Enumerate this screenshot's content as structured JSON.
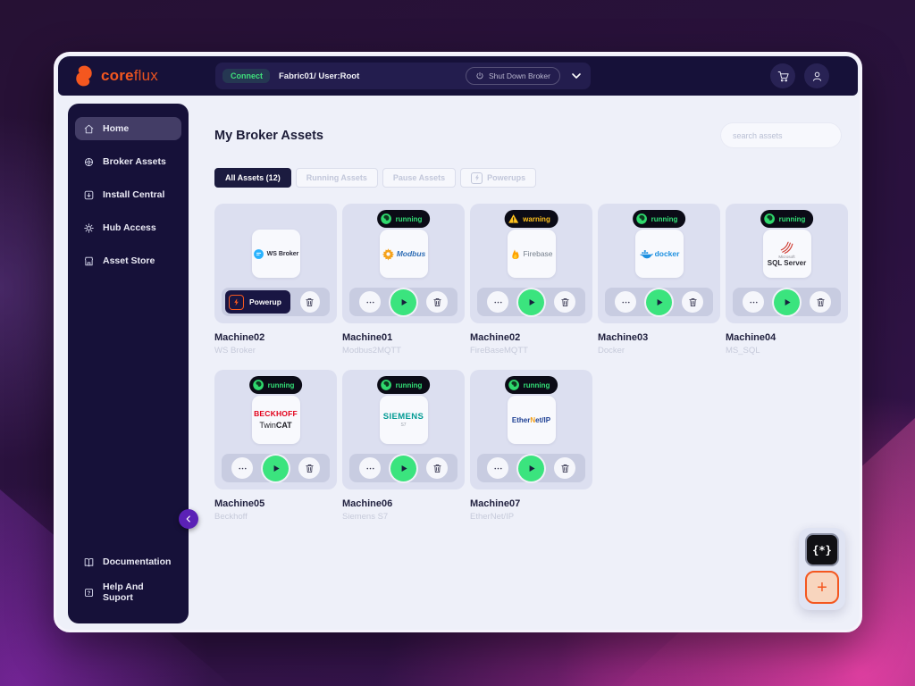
{
  "colors": {
    "accent_orange": "#F4571F",
    "running_green": "#33E077",
    "warning_yellow": "#FFC21D",
    "navy": "#161139",
    "collapse_purple": "#5B21B6"
  },
  "topbar": {
    "logo_bold": "core",
    "logo_light": "flux",
    "connect_label": "Connect",
    "fabric_user": "Fabric01/ User:Root",
    "shutdown_label": "Shut Down Broker",
    "icons": [
      "cart-icon",
      "account-icon",
      "chevron-down-icon"
    ]
  },
  "sidebar": {
    "items": [
      {
        "label": "Home",
        "icon": "home-icon",
        "active": true
      },
      {
        "label": "Broker Assets",
        "icon": "broker-assets-icon",
        "active": false
      },
      {
        "label": "Install Central",
        "icon": "install-central-icon",
        "active": false
      },
      {
        "label": "Hub Access",
        "icon": "hub-access-icon",
        "active": false
      },
      {
        "label": "Asset Store",
        "icon": "asset-store-icon",
        "active": false
      }
    ],
    "footer": [
      {
        "label": "Documentation",
        "icon": "documentation-icon"
      },
      {
        "label": "Help And Suport",
        "icon": "help-icon"
      }
    ]
  },
  "main": {
    "title": "My Broker Assets",
    "search_placeholder": "search assets",
    "filters": [
      {
        "label": "All Assets (12)",
        "active": true
      },
      {
        "label": "Running Assets",
        "active": false
      },
      {
        "label": "Pause Assets",
        "active": false
      },
      {
        "label": "Powerups",
        "active": false,
        "icon": "bolt-icon"
      }
    ],
    "powerup_label": "Powerup",
    "cards": [
      {
        "name": "Machine02",
        "subtitle": "WS Broker",
        "status": "",
        "logo": {
          "text": "WS Broker"
        }
      },
      {
        "name": "Machine01",
        "subtitle": "Modbus2MQTT",
        "status": "running",
        "logo": {
          "text": "Modbus"
        }
      },
      {
        "name": "Machine02",
        "subtitle": "FireBaseMQTT",
        "status": "warning",
        "logo": {
          "text": "Firebase"
        }
      },
      {
        "name": "Machine03",
        "subtitle": "Docker",
        "status": "running",
        "logo": {
          "text": "docker"
        }
      },
      {
        "name": "Machine04",
        "subtitle": "MS_SQL",
        "status": "running",
        "logo": {
          "small": "Microsoft",
          "text": "SQL Server"
        }
      },
      {
        "name": "Machine05",
        "subtitle": "Beckhoff",
        "status": "running",
        "logo": {
          "line1": "BECKHOFF",
          "line2a": "Twin",
          "line2b": "CAT"
        }
      },
      {
        "name": "Machine06",
        "subtitle": "Siemens S7",
        "status": "running",
        "logo": {
          "line1": "SIEMENS",
          "line2": "S7"
        }
      },
      {
        "name": "Machine07",
        "subtitle": "EtherNet/IP",
        "status": "running",
        "logo": {
          "pre": "Ether",
          "mid": "N",
          "post": "et/IP"
        }
      }
    ]
  },
  "fab": {
    "code_glyph": "{*}",
    "plus_glyph": "+"
  }
}
